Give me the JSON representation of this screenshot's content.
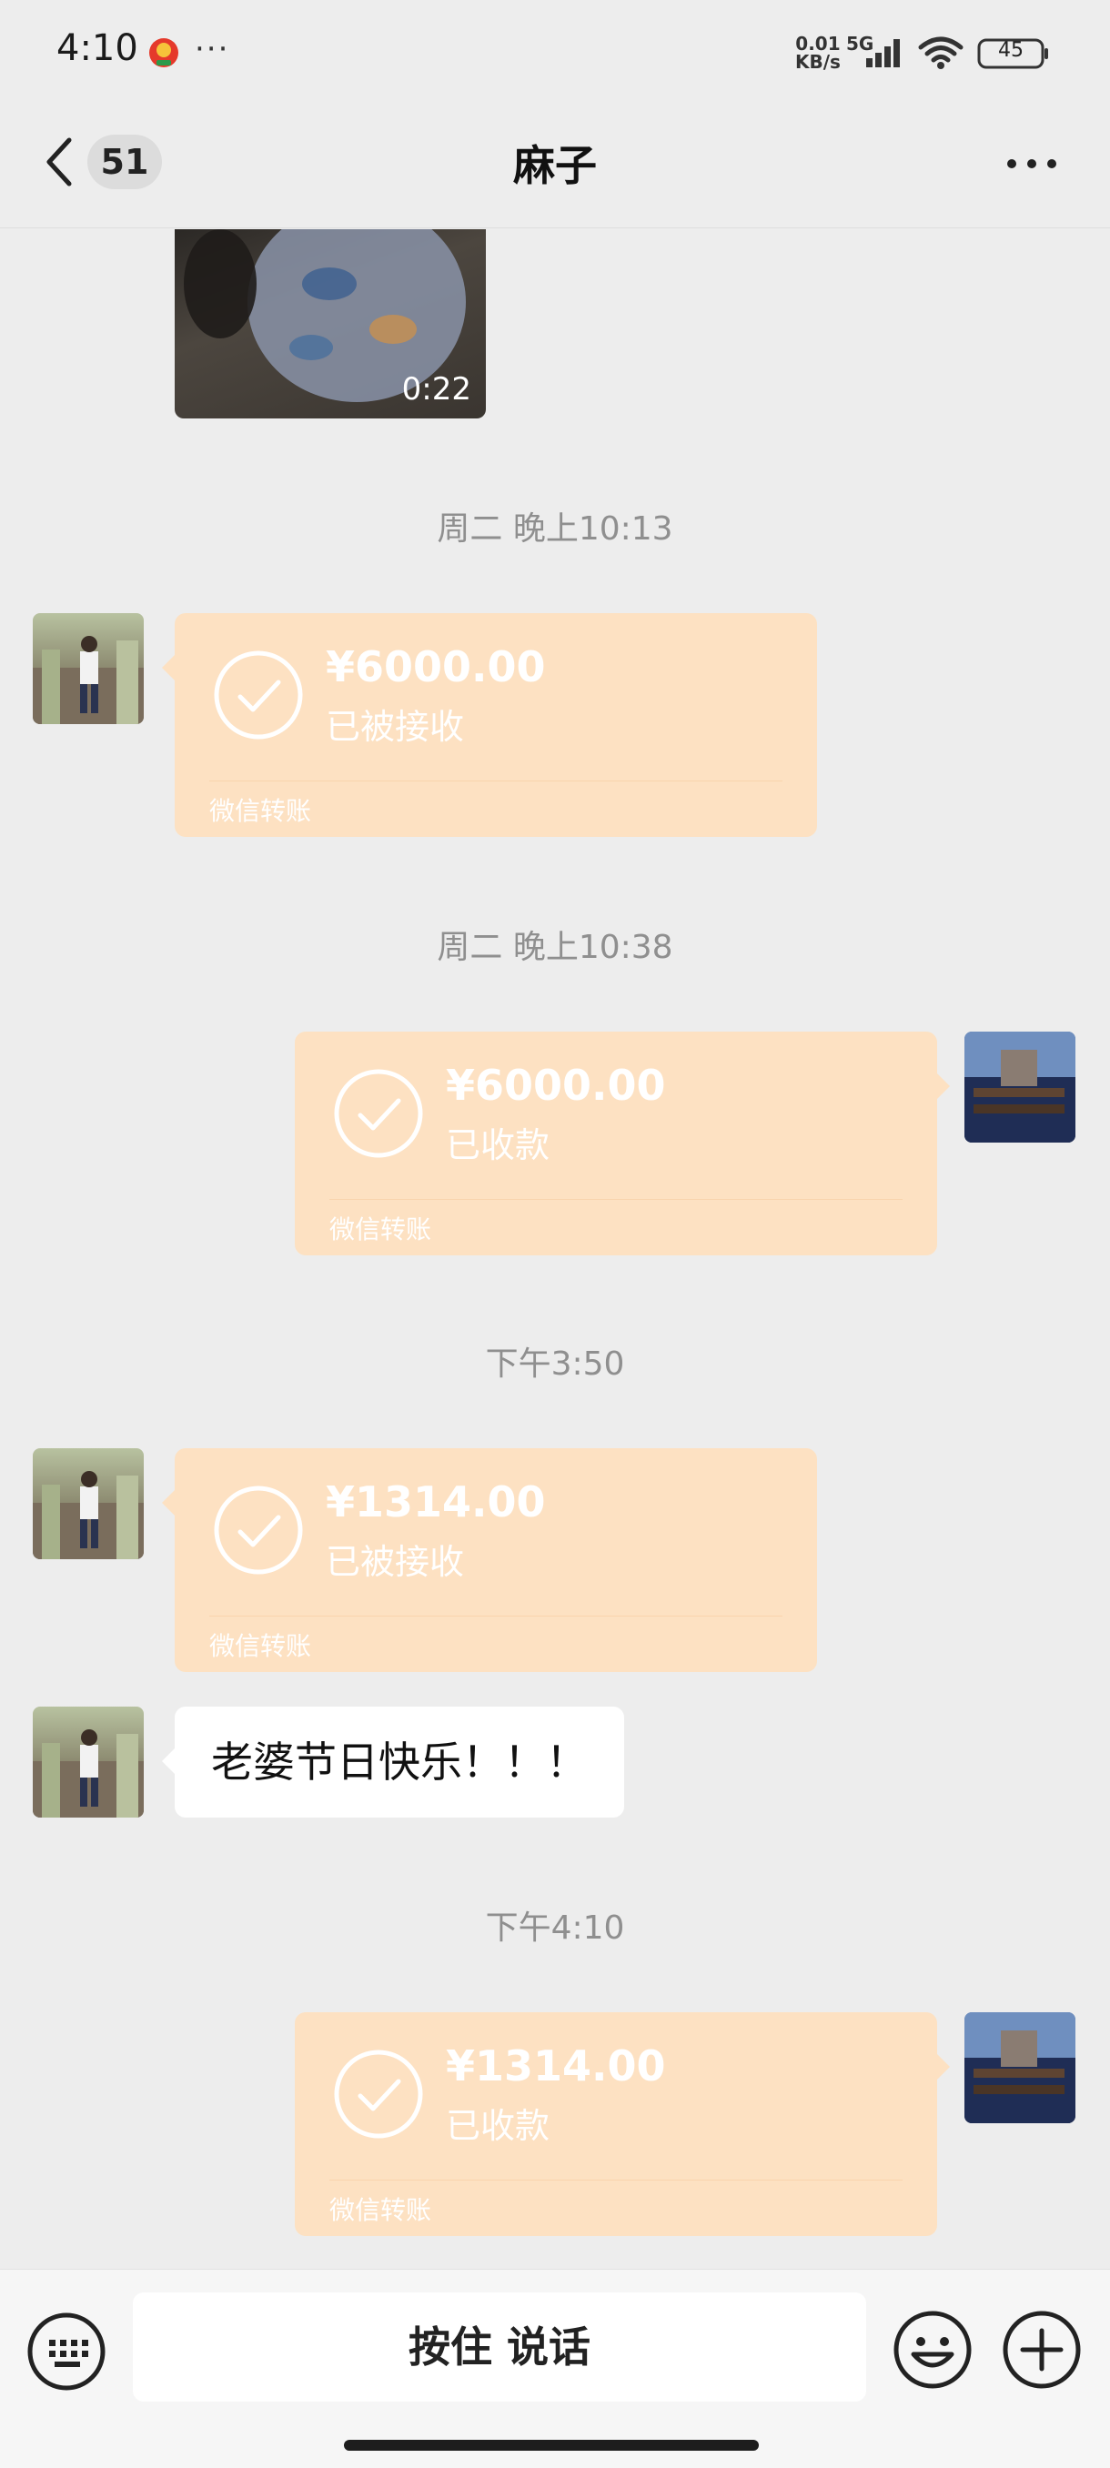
{
  "status_bar": {
    "time": "4:10",
    "more": "···",
    "net_speed_value": "0.01",
    "net_speed_unit": "KB/s",
    "network": "5G",
    "battery": "45"
  },
  "header": {
    "unread_count": "51",
    "title": "麻子"
  },
  "video": {
    "duration": "0:22"
  },
  "messages": {
    "ts1": "周二 晚上10:13",
    "transfer1": {
      "amount": "¥6000.00",
      "status": "已被接收",
      "footer": "微信转账"
    },
    "ts2": "周二 晚上10:38",
    "transfer2": {
      "amount": "¥6000.00",
      "status": "已收款",
      "footer": "微信转账"
    },
    "ts3": "下午3:50",
    "transfer3": {
      "amount": "¥1314.00",
      "status": "已被接收",
      "footer": "微信转账"
    },
    "text1": "老婆节日快乐！！！",
    "ts4": "下午4:10",
    "transfer4": {
      "amount": "¥1314.00",
      "status": "已收款",
      "footer": "微信转账"
    }
  },
  "input_bar": {
    "voice_label": "按住 说话"
  },
  "colors": {
    "transfer_bubble": "#fde1c2",
    "background": "#ededed"
  }
}
